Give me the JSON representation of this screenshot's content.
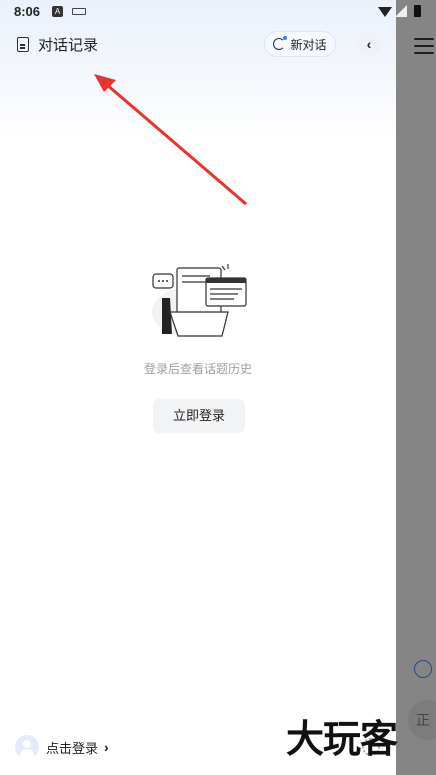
{
  "status_bar": {
    "time": "8:06",
    "icons": [
      "font-icon",
      "keyboard-icon",
      "wifi-icon",
      "signal-icon",
      "battery-icon"
    ]
  },
  "drawer": {
    "title": "对话记录",
    "new_chat_label": "新对话",
    "collapse_icon": "‹",
    "empty_message": "登录后查看话题历史",
    "login_button": "立即登录",
    "footer": {
      "label": "点击登录",
      "chevron": "›"
    }
  },
  "watermark": "大玩客",
  "background_app": {
    "icons": [
      "menu-icon",
      "globe-icon"
    ],
    "partial_text": "正"
  },
  "colors": {
    "annotation_arrow": "#e8322d",
    "accent": "#3a7bf6"
  }
}
